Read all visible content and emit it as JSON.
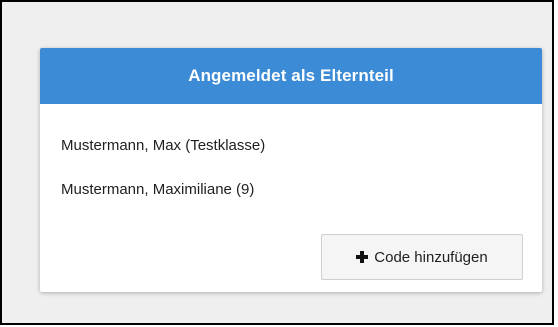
{
  "panel": {
    "header_title": "Angemeldet als Elternteil",
    "children": [
      {
        "label": "Mustermann, Max (Testklasse)"
      },
      {
        "label": "Mustermann, Maximiliane (9)"
      }
    ],
    "add_code_button_label": "Code hinzufügen"
  },
  "icons": {
    "add_code_icon": "plus-icon"
  },
  "colors": {
    "header_background": "#3b8bd6",
    "page_background": "#efefef"
  }
}
